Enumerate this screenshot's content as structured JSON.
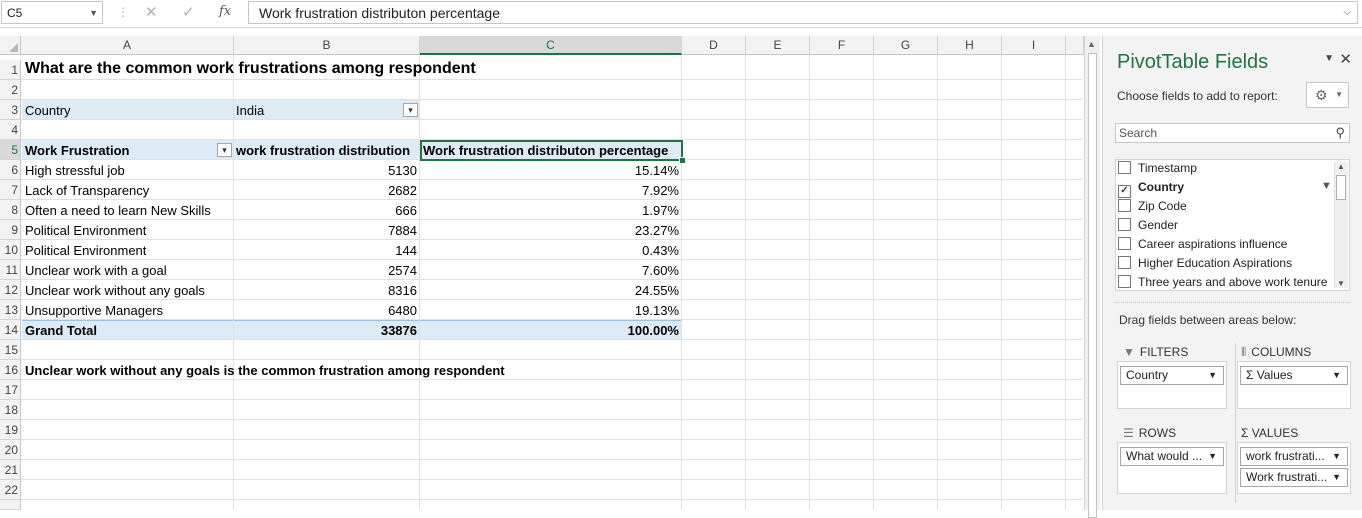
{
  "formula_bar": {
    "name_box": "C5",
    "cancel_icon": "✕",
    "enter_icon": "✓",
    "fx_label": "fx",
    "formula": "Work frustration distributon percentage"
  },
  "columns": [
    "A",
    "B",
    "C",
    "D",
    "E",
    "F",
    "G",
    "H",
    "I"
  ],
  "rows": [
    "1",
    "2",
    "3",
    "4",
    "5",
    "6",
    "7",
    "8",
    "9",
    "10",
    "11",
    "12",
    "13",
    "14",
    "15",
    "16",
    "17",
    "18",
    "19",
    "20",
    "21",
    "22"
  ],
  "sheet": {
    "title": "What are the common work frustrations among respondent",
    "filter_label": "Country",
    "filter_value": "India",
    "headers": [
      "Work Frustration",
      "work frustration distribution",
      "Work frustration distributon percentage"
    ],
    "data_rows": [
      {
        "label": "High stressful job",
        "count": "5130",
        "pct": "15.14%"
      },
      {
        "label": "Lack of Transparency",
        "count": "2682",
        "pct": "7.92%"
      },
      {
        "label": "Often a need to learn New Skills",
        "count": "666",
        "pct": "1.97%"
      },
      {
        "label": "Political Environment",
        "count": "7884",
        "pct": "23.27%"
      },
      {
        "label": "Political Environment",
        "count": "144",
        "pct": "0.43%"
      },
      {
        "label": "Unclear work with a goal",
        "count": "2574",
        "pct": "7.60%"
      },
      {
        "label": "Unclear work without any goals",
        "count": "8316",
        "pct": "24.55%"
      },
      {
        "label": "Unsupportive Managers",
        "count": "6480",
        "pct": "19.13%"
      }
    ],
    "grand_total": {
      "label": "Grand Total",
      "count": "33876",
      "pct": "100.00%"
    },
    "conclusion": "Unclear work without any goals is the common frustration among respondent"
  },
  "pivot_pane": {
    "title": "PivotTable Fields",
    "subtitle": "Choose fields to add to report:",
    "search_placeholder": "Search",
    "fields": [
      {
        "label": "Timestamp",
        "checked": false
      },
      {
        "label": "Country",
        "checked": true
      },
      {
        "label": "Zip Code",
        "checked": false
      },
      {
        "label": "Gender",
        "checked": false
      },
      {
        "label": "Career aspirations influence",
        "checked": false
      },
      {
        "label": "Higher Education Aspirations",
        "checked": false
      },
      {
        "label": "Three years and above work tenure",
        "checked": false
      }
    ],
    "drag_label": "Drag fields between areas below:",
    "areas": {
      "filters": {
        "title": "FILTERS",
        "items": [
          "Country"
        ]
      },
      "columns": {
        "title": "COLUMNS",
        "items": [
          "Σ Values"
        ]
      },
      "rows": {
        "title": "ROWS",
        "items": [
          "What would ..."
        ]
      },
      "values": {
        "title": "Σ VALUES",
        "items": [
          "work frustrati...",
          "Work frustrati..."
        ]
      }
    }
  },
  "colors": {
    "accent": "#217346",
    "pivot_band": "#ddebf7",
    "grid": "#e1e1e1"
  }
}
